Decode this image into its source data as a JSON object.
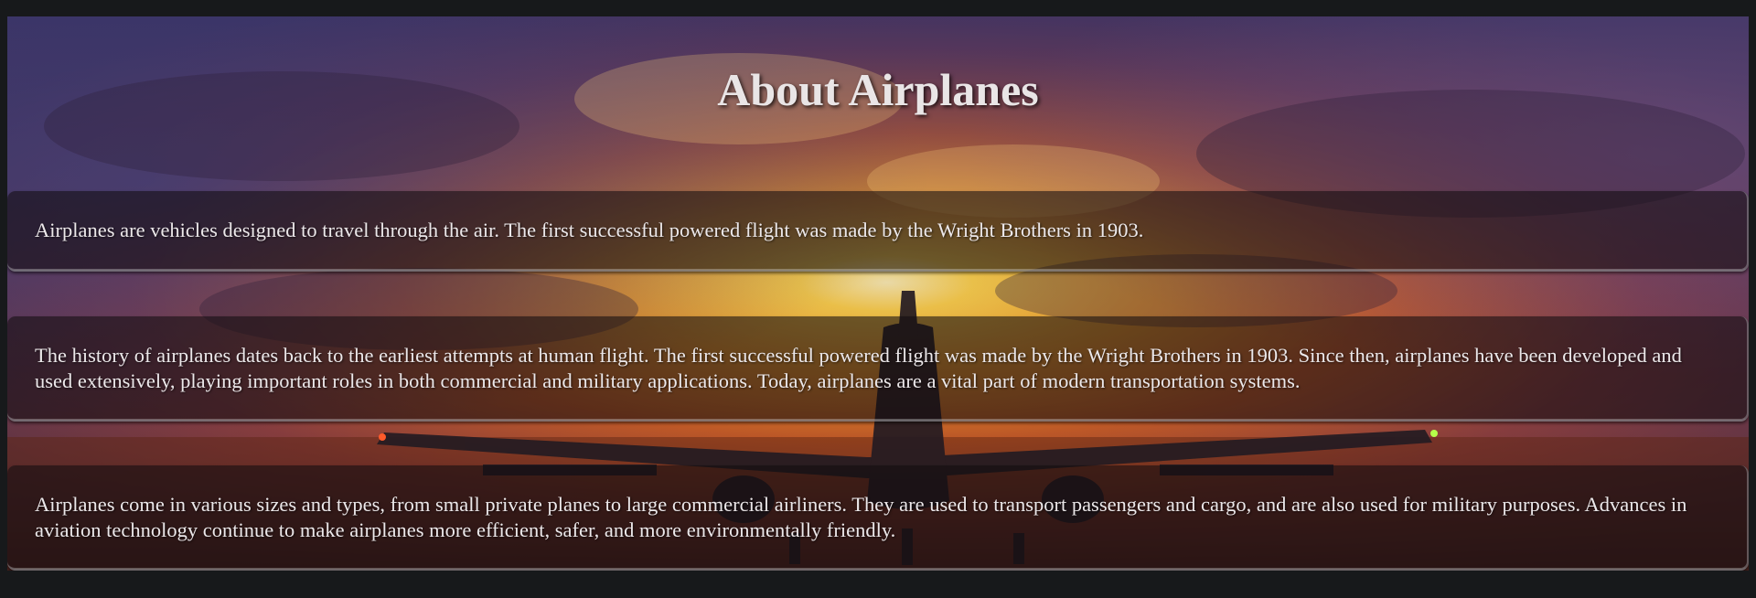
{
  "page": {
    "title": "About Airplanes"
  },
  "sections": [
    {
      "text": "Airplanes are vehicles designed to travel through the air. The first successful powered flight was made by the Wright Brothers in 1903."
    },
    {
      "text": "The history of airplanes dates back to the earliest attempts at human flight. The first successful powered flight was made by the Wright Brothers in 1903. Since then, airplanes have been developed and used extensively, playing important roles in both commercial and military applications. Today, airplanes are a vital part of modern transportation systems."
    },
    {
      "text": "Airplanes come in various sizes and types, from small private planes to large commercial airliners. They are used to transport passengers and cargo, and are also used for military purposes. Advances in aviation technology continue to make airplanes more efficient, safer, and more environmentally friendly."
    }
  ],
  "colors": {
    "page_background": "#17191b",
    "sky_glow": "#f2b233",
    "sky_purple": "#4e3f70",
    "card_overlay": "rgba(18,12,16,0.58)",
    "text": "#ece8ea"
  }
}
